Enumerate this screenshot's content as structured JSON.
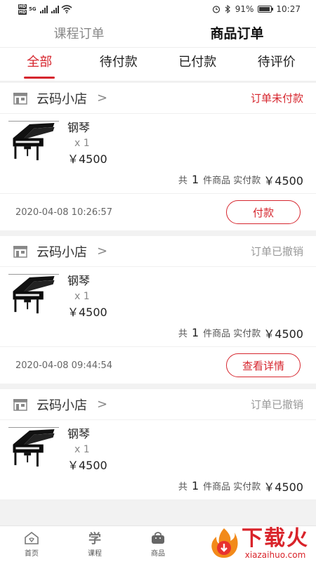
{
  "status_bar": {
    "hd1": "HD",
    "hd2": "HD",
    "net": "5G",
    "battery_pct": "91%",
    "battery_level": 0.91,
    "time": "10:27"
  },
  "top_tabs": [
    {
      "label": "课程订单",
      "active": false
    },
    {
      "label": "商品订单",
      "active": true
    }
  ],
  "sub_tabs": [
    {
      "label": "全部",
      "active": true
    },
    {
      "label": "待付款",
      "active": false
    },
    {
      "label": "已付款",
      "active": false
    },
    {
      "label": "待评价",
      "active": false
    }
  ],
  "orders": [
    {
      "shop": "云码小店",
      "chevron": ">",
      "status": "订单未付款",
      "product_name": "钢琴",
      "qty": "x 1",
      "price": "￥4500",
      "summary_prefix": "共",
      "count": "1",
      "summary_mid": "件商品 实付款",
      "total": "￥4500",
      "time": "2020-04-08 10:26:57",
      "action": "付款"
    },
    {
      "shop": "云码小店",
      "chevron": ">",
      "status": "订单已撤销",
      "product_name": "钢琴",
      "qty": "x 1",
      "price": "￥4500",
      "summary_prefix": "共",
      "count": "1",
      "summary_mid": "件商品 实付款",
      "total": "￥4500",
      "time": "2020-04-08 09:44:54",
      "action": "查看详情"
    },
    {
      "shop": "云码小店",
      "chevron": ">",
      "status": "订单已撤销",
      "product_name": "钢琴",
      "qty": "x 1",
      "price": "￥4500",
      "summary_prefix": "共",
      "count": "1",
      "summary_mid": "件商品 实付款",
      "total": "￥4500"
    }
  ],
  "tabbar": {
    "home": "首页",
    "course_glyph": "学",
    "course": "课程",
    "goods": "商品"
  },
  "watermark": {
    "title": "下载火",
    "url": "xiazaihuo.com"
  },
  "colors": {
    "accent": "#d6262e",
    "muted": "#999999"
  }
}
